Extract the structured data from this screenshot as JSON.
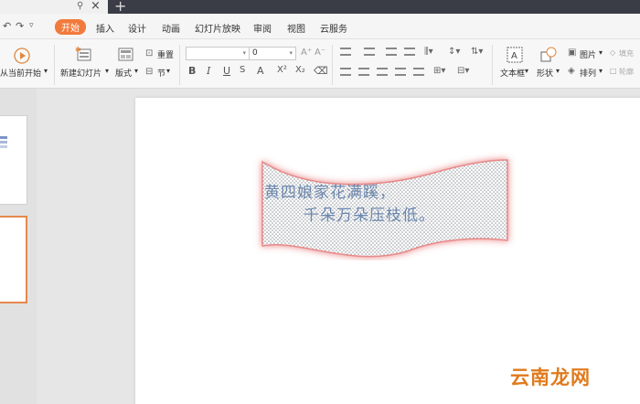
{
  "menu": {
    "tabs": [
      {
        "label": "开始",
        "active": true
      },
      {
        "label": "插入"
      },
      {
        "label": "设计"
      },
      {
        "label": "动画"
      },
      {
        "label": "幻灯片放映"
      },
      {
        "label": "审阅"
      },
      {
        "label": "视图"
      },
      {
        "label": "云服务"
      }
    ]
  },
  "ribbon": {
    "play_from_current": "从当前开始",
    "new_slide": "新建幻灯片",
    "layout": "版式",
    "reset": "重置",
    "section": "节",
    "font_size_value": "0",
    "textbox": "文本框",
    "shape": "形状",
    "picture": "图片",
    "arrange": "排列",
    "fill": "填充",
    "outline": "轮廓"
  },
  "slide": {
    "poem_line1": "黄四娘家花满蹊，",
    "poem_line2": "千朵万朵压枝低。"
  },
  "colors": {
    "accent": "#f27a3c",
    "text_color": "#6a86ad",
    "glow": "#e86a6a"
  },
  "watermark": "云南龙网"
}
